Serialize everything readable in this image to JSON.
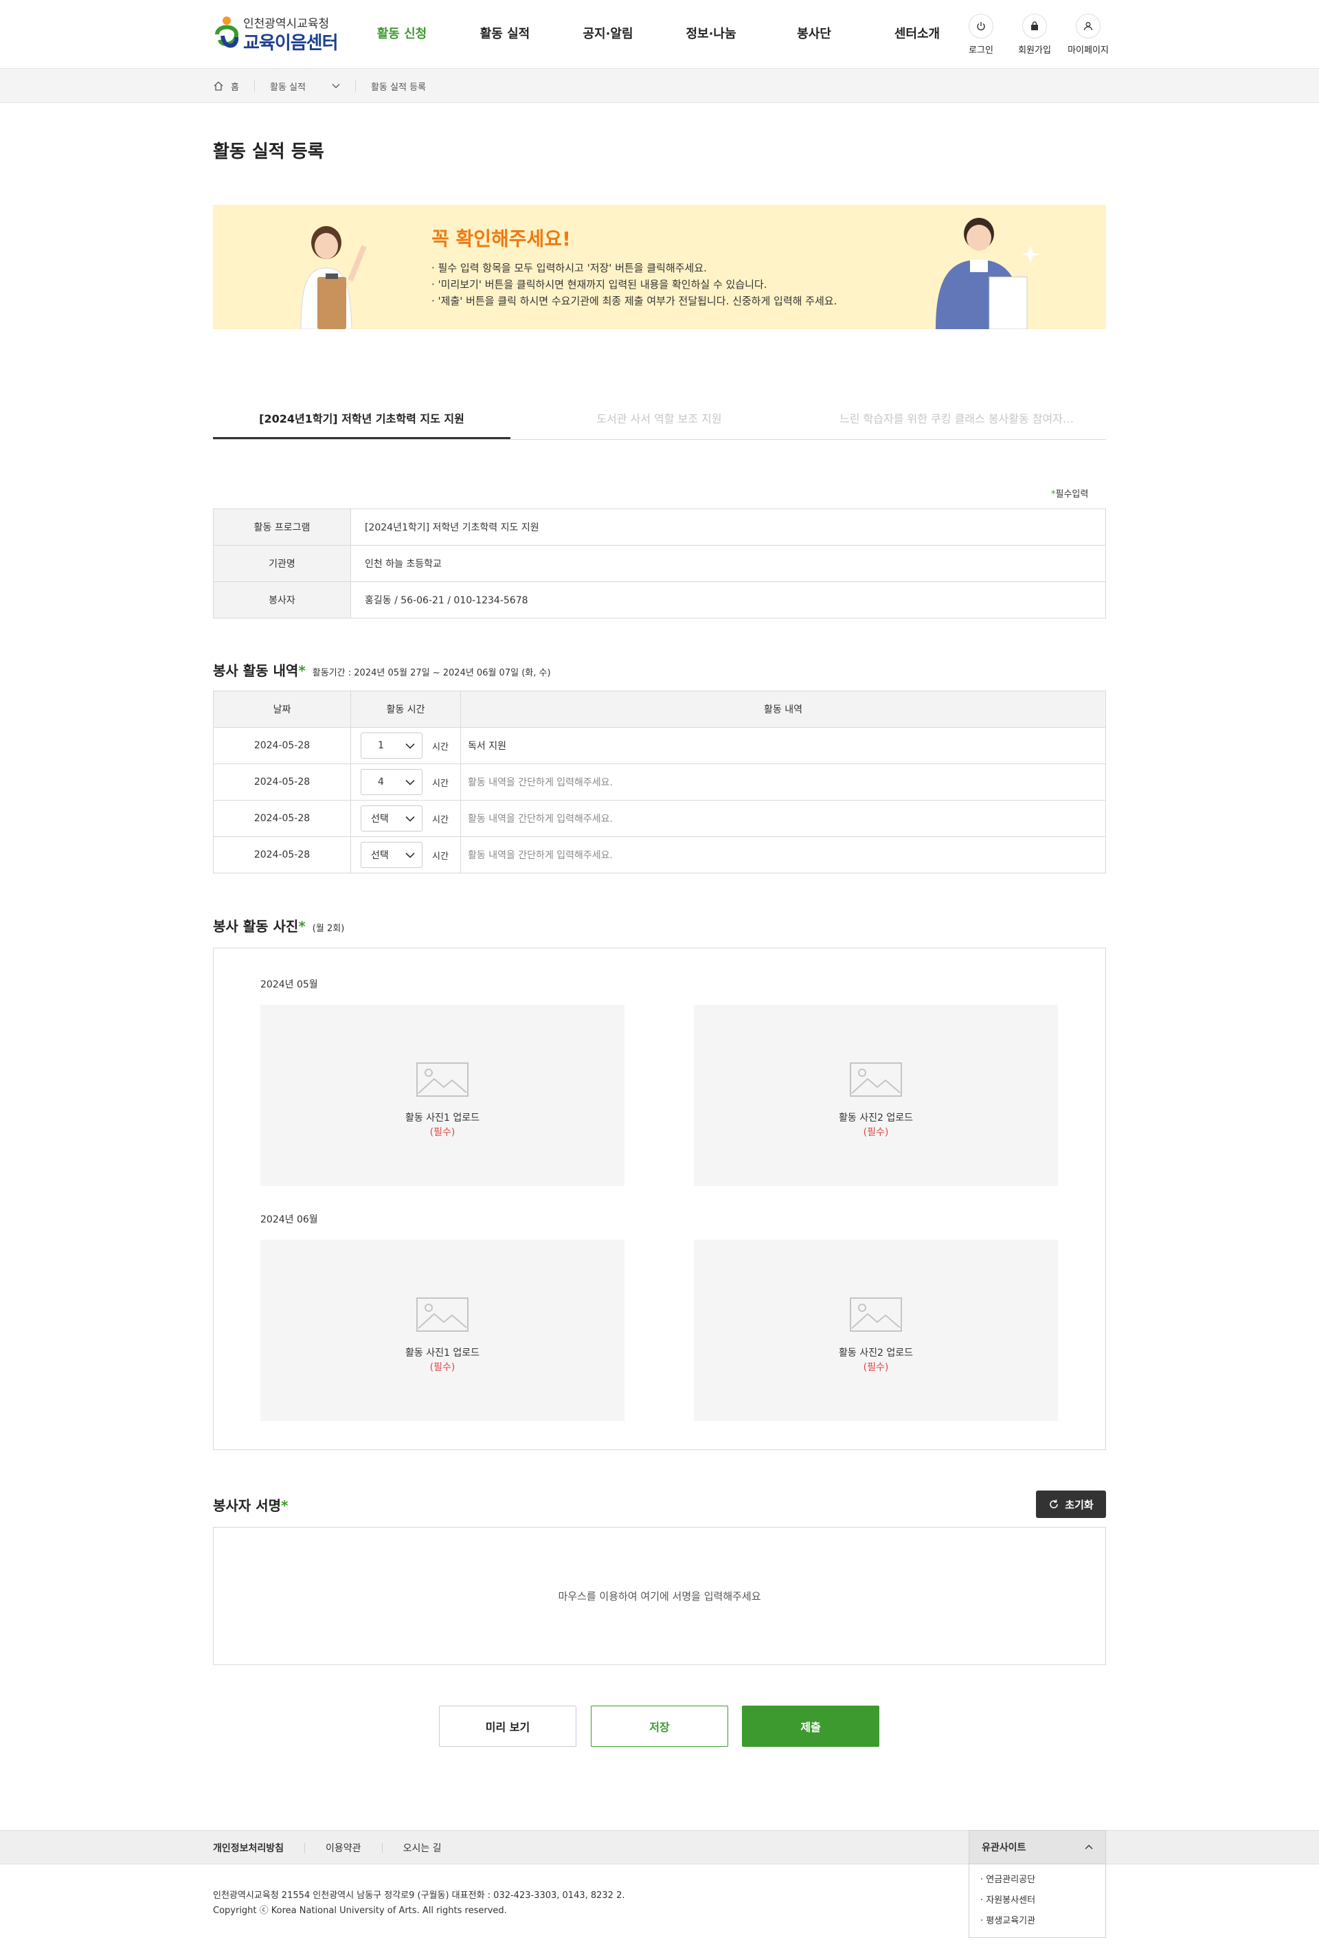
{
  "header": {
    "logo_line1": "인천광역시교육청",
    "logo_line2": "교육이음센터",
    "nav": [
      "활동 신청",
      "활동 실적",
      "공지·알림",
      "정보·나눔",
      "봉사단",
      "센터소개"
    ],
    "util": {
      "login": "로그인",
      "join": "회원가입",
      "mypage": "마이페이지"
    }
  },
  "breadcrumb": {
    "home": "홈",
    "level1": "활동 실적",
    "level2": "활동 실적 등록"
  },
  "page_title": "활동 실적 등록",
  "notice": {
    "title": "꼭 확인해주세요!",
    "items": [
      "· 필수 입력 항목을 모두 입력하시고 '저장' 버튼을 클릭해주세요.",
      "· '미리보기' 버튼을 클릭하시면 현재까지 입력된 내용을 확인하실 수 있습니다.",
      "· '제출' 버튼을 클릭 하시면 수요기관에 최종 제출 여부가 전달됩니다. 신중하게 입력해 주세요."
    ]
  },
  "tabs": [
    "[2024년1학기] 저학년 기초학력 지도 지원",
    "도서관 사서 역할 보조 지원",
    "느린 학습자를 위한 쿠킹 클래스 봉사활동 참여자…"
  ],
  "required_note_star": "*",
  "required_note": "필수입력",
  "info": {
    "program_label": "활동 프로그램",
    "program_value": "[2024년1학기] 저학년 기초학력 지도 지원",
    "org_label": "기관명",
    "org_value": "인천 하늘 초등학교",
    "volunteer_label": "봉사자",
    "volunteer_value": "홍길동 / 56-06-21 / 010-1234-5678"
  },
  "activity": {
    "title": "봉사 활동 내역",
    "star": "*",
    "period": "활동기간 : 2024년 05월 27일 ~ 2024년 06월 07일 (화, 수)",
    "headers": {
      "date": "날짜",
      "time": "활동 시간",
      "desc": "활동 내역"
    },
    "unit": "시간",
    "rows": [
      {
        "date": "2024-05-28",
        "time": "1",
        "desc": "독서 지원"
      },
      {
        "date": "2024-05-28",
        "time": "4",
        "desc": "활동 내역을 간단하게 입력해주세요."
      },
      {
        "date": "2024-05-28",
        "time": "선택",
        "desc": "활동 내역을 간단하게 입력해주세요."
      },
      {
        "date": "2024-05-28",
        "time": "선택",
        "desc": "활동 내역을 간단하게 입력해주세요."
      }
    ]
  },
  "photos": {
    "title": "봉사 활동 사진",
    "star": "*",
    "sub": "(월 2회)",
    "months": [
      "2024년 05월",
      "2024년 06월"
    ],
    "upload1": "활동 사진1 업로드",
    "upload2": "활동 사진2 업로드",
    "required": "(필수)"
  },
  "signature": {
    "title": "봉사자 서명",
    "star": "*",
    "reset": "초기화",
    "placeholder": "마우스를 이용하여 여기에 서명을 입력해주세요"
  },
  "buttons": {
    "preview": "미리 보기",
    "save": "저장",
    "submit": "제출"
  },
  "footer": {
    "privacy": "개인정보처리방침",
    "terms": "이용약관",
    "directions": "오시는 길",
    "address": "인천광역시교육청 21554 인천광역시 남동구 정각로9 (구월동) 대표전화 : 032-423-3303, 0143, 8232 2.",
    "copyright": "Copyright ⓒ Korea National University of Arts. All rights reserved.",
    "family_title": "유관사이트",
    "family_links": [
      "· 연금관리공단",
      "· 자원봉사센터",
      "· 평생교육기관"
    ]
  },
  "colors": {
    "accent": "#3c9a2e",
    "notice_bg": "#fff3c7",
    "notice_title": "#ef7a12",
    "required": "#e24646"
  }
}
